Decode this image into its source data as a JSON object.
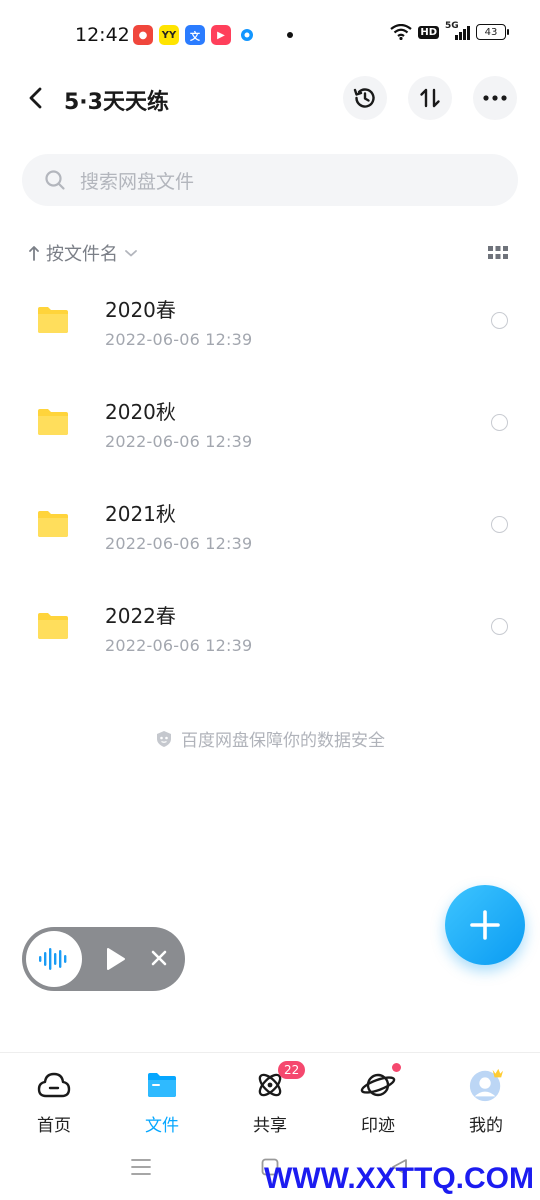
{
  "status_bar": {
    "time": "12:42",
    "signal_label": "5G",
    "battery_level": "43",
    "hd_label": "HD"
  },
  "header": {
    "title": "5·3天天练"
  },
  "search": {
    "placeholder": "搜索网盘文件"
  },
  "sort": {
    "label": "按文件名"
  },
  "files": [
    {
      "name": "2020春",
      "date": "2022-06-06  12:39"
    },
    {
      "name": "2020秋",
      "date": "2022-06-06  12:39"
    },
    {
      "name": "2021秋",
      "date": "2022-06-06  12:39"
    },
    {
      "name": "2022春",
      "date": "2022-06-06  12:39"
    }
  ],
  "safety_note": "百度网盘保障你的数据安全",
  "bottom_nav": {
    "items": [
      {
        "label": "首页",
        "icon": "cloud-icon"
      },
      {
        "label": "文件",
        "icon": "folder-icon",
        "active": true
      },
      {
        "label": "共享",
        "icon": "orbit-icon",
        "badge": "22"
      },
      {
        "label": "印迹",
        "icon": "planet-icon"
      },
      {
        "label": "我的",
        "icon": "avatar-icon"
      }
    ]
  },
  "watermark": "WWW.XXTTQ.COM",
  "colors": {
    "accent": "#06a7ff",
    "folder": "#ffd43b",
    "badge": "#f5486e"
  }
}
